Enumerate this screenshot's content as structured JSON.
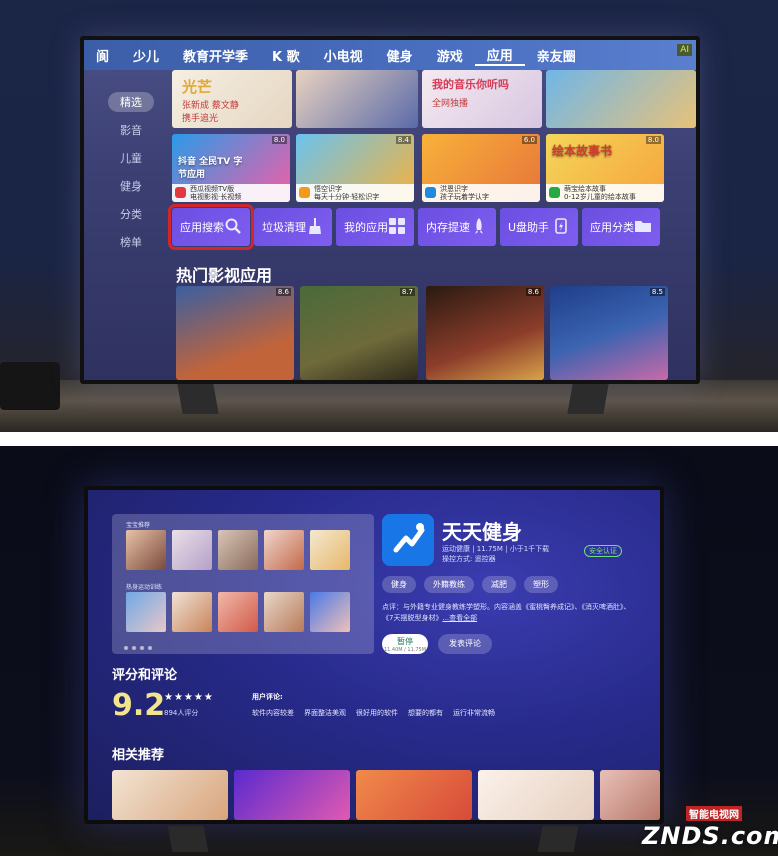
{
  "screen1": {
    "nav_tabs": [
      "阆",
      "少儿",
      "教育开学季",
      "K 歌",
      "小电视",
      "健身",
      "游戏",
      "应用",
      "亲友圈"
    ],
    "active_tab": "应用",
    "ai_tag": "AI",
    "sidebar": [
      "精选",
      "影音",
      "儿童",
      "健身",
      "分类",
      "榜单"
    ],
    "banners": [
      {
        "title": "光芒",
        "subtitle": "张新成 蔡文静\n携手追光"
      },
      {
        "title": "",
        "subtitle": ""
      },
      {
        "title": "我的音乐你听吗",
        "subtitle": "全网独播"
      },
      {
        "title": "",
        "subtitle": ""
      }
    ],
    "app_cards": [
      {
        "art_title": "抖音 全民TV 字节应用",
        "score": "8.0",
        "caption": "西瓜视频TV版\n电视影视·长视频",
        "icon_color": "#e0393e"
      },
      {
        "art_title": "",
        "score": "8.4",
        "caption": "悟空识字\n每天十分钟·轻松识字",
        "icon_color": "#f29a1c"
      },
      {
        "art_title": "",
        "score": "6.0",
        "caption": "洪恩识字\n孩子玩着学认字",
        "icon_color": "#1f8ae0"
      },
      {
        "art_title": "绘本故事书",
        "score": "8.0",
        "caption": "萌宝绘本故事\n0-12岁儿童的绘本故事",
        "icon_color": "#27a845"
      }
    ],
    "tools": [
      {
        "label": "应用搜索",
        "icon": "search-icon",
        "glyph": "🔍"
      },
      {
        "label": "垃圾清理",
        "icon": "broom-icon",
        "glyph": "🧹"
      },
      {
        "label": "我的应用",
        "icon": "grid-icon",
        "glyph": "▦"
      },
      {
        "label": "内存提速",
        "icon": "rocket-icon",
        "glyph": "🚀"
      },
      {
        "label": "U盘助手",
        "icon": "usb-icon",
        "glyph": "⚡"
      },
      {
        "label": "应用分类",
        "icon": "folder-icon",
        "glyph": "🗂"
      }
    ],
    "section_title": "热门影视应用",
    "posters": [
      {
        "score": "8.6",
        "color": "#c2643a"
      },
      {
        "score": "8.7",
        "color": "#6f6a3a"
      },
      {
        "score": "8.6",
        "color": "#8c3d2a"
      },
      {
        "score": "8.5",
        "color": "#3a63b0"
      }
    ]
  },
  "screen2": {
    "gallery_labels": [
      "宝宝推荐",
      "热身运动训练"
    ],
    "app_title": "天天健身",
    "app_meta_line1": "运动健康 | 11.75M | 小于1千下载",
    "app_meta_line2": "操控方式: 遥控器",
    "safe_badge": "安全认证",
    "tags": [
      "健身",
      "外籍教练",
      "减肥",
      "塑形"
    ],
    "desc": "点评：与外籍专业健身教练学塑形。内容涵盖《蜜桃臀养成记》、《消灭啤酒肚》、《7天摆脱型身材》",
    "desc_more": "...查看全部",
    "pause_label": "暂停",
    "pause_progress": "11.40M / 11.75M",
    "review_button": "发表评论",
    "reviews_heading": "评分和评论",
    "score": "9.2",
    "stars": "★★★★★",
    "rating_count": "894人评分",
    "user_comments_label": "用户评论:",
    "comments": [
      "软件内容较差",
      "界面整洁美观",
      "很好用的软件",
      "想要的都有",
      "运行非常流畅"
    ],
    "related_heading": "相关推荐",
    "related": [
      {
        "color": "#e4c3a2"
      },
      {
        "color": "#7a3ad8"
      },
      {
        "color": "#e45a3c"
      },
      {
        "color": "#f2e6dc"
      }
    ]
  },
  "watermark": {
    "site": "智能电视网",
    "logo": "ZNDS.com"
  }
}
